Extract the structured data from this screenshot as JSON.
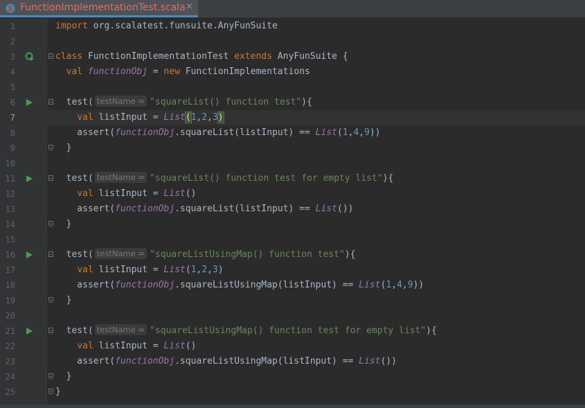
{
  "tab": {
    "title": "FunctionImplementationTest.scala",
    "close_glyph": "×",
    "icon": "scala-file-icon",
    "title_color": "#e06c6c"
  },
  "colors": {
    "keyword": "#cc7832",
    "string": "#6a8759",
    "number": "#6897bb",
    "italic_purple": "#9876aa",
    "default": "#a9b7c6",
    "run_green": "#499c54"
  },
  "current_line": 7,
  "lines": [
    {
      "n": "1",
      "tokens": [
        {
          "t": "import",
          "c": "kw"
        },
        {
          "t": " org.scalatest.funsuite.AnyFunSuite"
        }
      ]
    },
    {
      "n": "2",
      "tokens": []
    },
    {
      "n": "3",
      "gutter": "runall",
      "fold": "start",
      "tokens": [
        {
          "t": "class",
          "c": "kw"
        },
        {
          "t": " FunctionImplementationTest "
        },
        {
          "t": "extends",
          "c": "kw"
        },
        {
          "t": " AnyFunSuite {"
        }
      ]
    },
    {
      "n": "4",
      "tokens": [
        {
          "t": "  "
        },
        {
          "t": "val",
          "c": "kw"
        },
        {
          "t": " "
        },
        {
          "t": "functionObj",
          "c": "fld"
        },
        {
          "t": " = "
        },
        {
          "t": "new",
          "c": "kw"
        },
        {
          "t": " FunctionImplementations"
        }
      ]
    },
    {
      "n": "5",
      "tokens": []
    },
    {
      "n": "6",
      "gutter": "run",
      "fold": "start",
      "tokens": [
        {
          "t": "  test("
        },
        {
          "t": "testName =",
          "c": "hint"
        },
        {
          "t": "\"squareList() function test\"",
          "c": "str"
        },
        {
          "t": "){"
        }
      ]
    },
    {
      "n": "7",
      "tokens": [
        {
          "t": "    "
        },
        {
          "t": "val",
          "c": "kw"
        },
        {
          "t": " listInput = "
        },
        {
          "t": "List",
          "c": "fn"
        },
        {
          "t": "(",
          "c": "br"
        },
        {
          "t": "1",
          "c": "num"
        },
        {
          "t": ","
        },
        {
          "t": "2",
          "c": "num"
        },
        {
          "t": ","
        },
        {
          "t": "3",
          "c": "num"
        },
        {
          "t": ")",
          "c": "br"
        }
      ]
    },
    {
      "n": "8",
      "tokens": [
        {
          "t": "    assert("
        },
        {
          "t": "functionObj",
          "c": "fld"
        },
        {
          "t": ".squareList(listInput) == "
        },
        {
          "t": "List",
          "c": "fn"
        },
        {
          "t": "("
        },
        {
          "t": "1",
          "c": "num"
        },
        {
          "t": ","
        },
        {
          "t": "4",
          "c": "num"
        },
        {
          "t": ","
        },
        {
          "t": "9",
          "c": "num"
        },
        {
          "t": "))"
        }
      ]
    },
    {
      "n": "9",
      "fold": "end",
      "tokens": [
        {
          "t": "  }"
        }
      ]
    },
    {
      "n": "10",
      "tokens": []
    },
    {
      "n": "11",
      "gutter": "run",
      "fold": "start",
      "tokens": [
        {
          "t": "  test("
        },
        {
          "t": "testName =",
          "c": "hint"
        },
        {
          "t": "\"squareList() function test for empty list\"",
          "c": "str"
        },
        {
          "t": "){"
        }
      ]
    },
    {
      "n": "12",
      "tokens": [
        {
          "t": "    "
        },
        {
          "t": "val",
          "c": "kw"
        },
        {
          "t": " listInput = "
        },
        {
          "t": "List",
          "c": "fn"
        },
        {
          "t": "()"
        }
      ]
    },
    {
      "n": "13",
      "tokens": [
        {
          "t": "    assert("
        },
        {
          "t": "functionObj",
          "c": "fld"
        },
        {
          "t": ".squareList(listInput) == "
        },
        {
          "t": "List",
          "c": "fn"
        },
        {
          "t": "())"
        }
      ]
    },
    {
      "n": "14",
      "fold": "end",
      "tokens": [
        {
          "t": "  }"
        }
      ]
    },
    {
      "n": "15",
      "tokens": []
    },
    {
      "n": "16",
      "gutter": "run",
      "fold": "start",
      "tokens": [
        {
          "t": "  test("
        },
        {
          "t": "testName =",
          "c": "hint"
        },
        {
          "t": "\"squareListUsingMap() function test\"",
          "c": "str"
        },
        {
          "t": "){"
        }
      ]
    },
    {
      "n": "17",
      "tokens": [
        {
          "t": "    "
        },
        {
          "t": "val",
          "c": "kw"
        },
        {
          "t": " listInput = "
        },
        {
          "t": "List",
          "c": "fn"
        },
        {
          "t": "("
        },
        {
          "t": "1",
          "c": "num"
        },
        {
          "t": ","
        },
        {
          "t": "2",
          "c": "num"
        },
        {
          "t": ","
        },
        {
          "t": "3",
          "c": "num"
        },
        {
          "t": ")"
        }
      ]
    },
    {
      "n": "18",
      "tokens": [
        {
          "t": "    assert("
        },
        {
          "t": "functionObj",
          "c": "fld"
        },
        {
          "t": ".squareListUsingMap(listInput) == "
        },
        {
          "t": "List",
          "c": "fn"
        },
        {
          "t": "("
        },
        {
          "t": "1",
          "c": "num"
        },
        {
          "t": ","
        },
        {
          "t": "4",
          "c": "num"
        },
        {
          "t": ","
        },
        {
          "t": "9",
          "c": "num"
        },
        {
          "t": "))"
        }
      ]
    },
    {
      "n": "19",
      "fold": "end",
      "tokens": [
        {
          "t": "  }"
        }
      ]
    },
    {
      "n": "20",
      "tokens": []
    },
    {
      "n": "21",
      "gutter": "run",
      "fold": "start",
      "tokens": [
        {
          "t": "  test("
        },
        {
          "t": "testName =",
          "c": "hint"
        },
        {
          "t": "\"squareListUsingMap() function test for empty list\"",
          "c": "str"
        },
        {
          "t": "){"
        }
      ]
    },
    {
      "n": "22",
      "tokens": [
        {
          "t": "    "
        },
        {
          "t": "val",
          "c": "kw"
        },
        {
          "t": " listInput = "
        },
        {
          "t": "List",
          "c": "fn"
        },
        {
          "t": "()"
        }
      ]
    },
    {
      "n": "23",
      "tokens": [
        {
          "t": "    assert("
        },
        {
          "t": "functionObj",
          "c": "fld"
        },
        {
          "t": ".squareListUsingMap(listInput) == "
        },
        {
          "t": "List",
          "c": "fn"
        },
        {
          "t": "())"
        }
      ]
    },
    {
      "n": "24",
      "fold": "end",
      "tokens": [
        {
          "t": "  }"
        }
      ]
    },
    {
      "n": "25",
      "fold": "end",
      "tokens": [
        {
          "t": "}"
        }
      ]
    }
  ]
}
